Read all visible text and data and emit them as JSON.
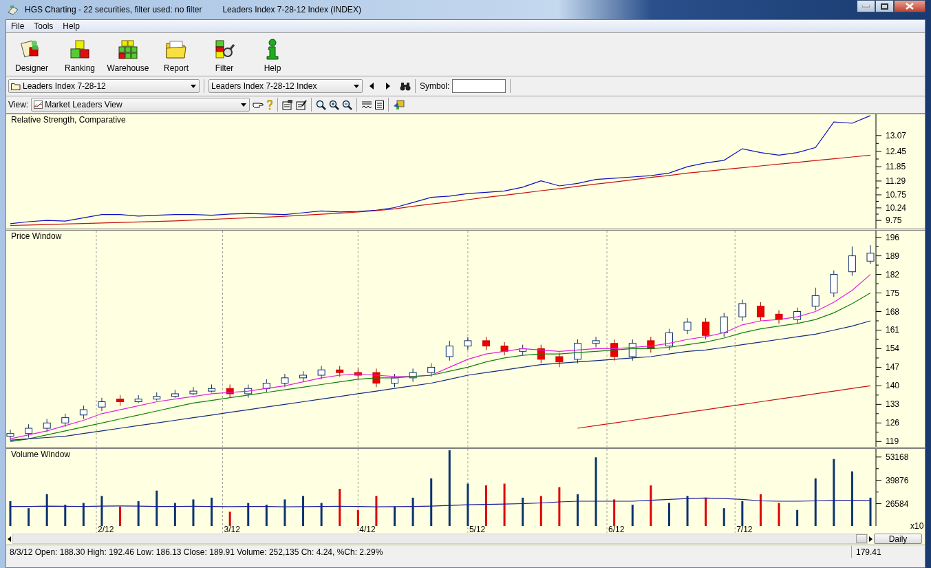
{
  "window": {
    "title": "HGS Charting - 22 securities, filter used: no filter",
    "subtitle": "Leaders Index 7-28-12 Index (INDEX)"
  },
  "menu": [
    {
      "label": "File"
    },
    {
      "label": "Tools"
    },
    {
      "label": "Help"
    }
  ],
  "toolbar": [
    {
      "label": "Designer",
      "kind": "designer"
    },
    {
      "label": "Ranking",
      "kind": "ranking"
    },
    {
      "label": "Warehouse",
      "kind": "warehouse"
    },
    {
      "label": "Report",
      "kind": "report"
    },
    {
      "label": "Filter",
      "kind": "filter"
    },
    {
      "label": "Help",
      "kind": "help"
    }
  ],
  "list_dropdown": {
    "value": "Leaders Index 7-28-12"
  },
  "security_dropdown": {
    "value": "Leaders Index 7-28-12 Index"
  },
  "symbol": {
    "label": "Symbol:"
  },
  "view": {
    "label": "View:",
    "value": "Market Leaders View"
  },
  "charts": [
    {
      "chart_data": {
        "type": "line",
        "title": "Relative Strength, Comparative",
        "ylim": [
          9.43,
          13.9
        ],
        "yticks": [
          13.07,
          12.45,
          11.85,
          11.29,
          10.75,
          10.24,
          9.75
        ],
        "series": [
          {
            "color": "#1010c0",
            "values": [
              9.62,
              9.7,
              9.75,
              9.72,
              9.85,
              9.98,
              9.98,
              9.92,
              9.95,
              9.98,
              9.98,
              9.95,
              10.0,
              10.02,
              10.0,
              9.98,
              10.05,
              10.12,
              10.08,
              10.1,
              10.15,
              10.25,
              10.45,
              10.65,
              10.7,
              10.8,
              10.85,
              10.9,
              11.05,
              11.3,
              11.1,
              11.2,
              11.35,
              11.4,
              11.45,
              11.5,
              11.6,
              11.85,
              12.0,
              12.1,
              12.55,
              12.4,
              12.3,
              12.4,
              12.6,
              13.6,
              13.55,
              13.85
            ]
          },
          {
            "color": "#c81010",
            "values": [
              9.55,
              9.57,
              9.59,
              9.61,
              9.63,
              9.65,
              9.67,
              9.69,
              9.71,
              9.73,
              9.76,
              9.79,
              9.82,
              9.85,
              9.88,
              9.91,
              9.95,
              9.99,
              10.03,
              10.08,
              10.13,
              10.2,
              10.3,
              10.39,
              10.47,
              10.56,
              10.65,
              10.73,
              10.82,
              10.91,
              10.99,
              11.08,
              11.17,
              11.25,
              11.34,
              11.43,
              11.51,
              11.6,
              11.67,
              11.74,
              11.81,
              11.88,
              11.95,
              12.02,
              12.09,
              12.16,
              12.23,
              12.3
            ]
          }
        ]
      }
    },
    {
      "chart_data": {
        "type": "candlestick",
        "title": "Price Window",
        "ylim": [
          117,
          198.5
        ],
        "yticks": [
          196,
          189,
          182,
          175,
          168,
          161,
          154,
          147,
          140,
          133,
          126,
          119
        ],
        "ohlc": [
          [
            121,
            123.5,
            119.5,
            122
          ],
          [
            122,
            125.5,
            120.5,
            124
          ],
          [
            124,
            127.5,
            122.5,
            126
          ],
          [
            126,
            129.5,
            124.5,
            128
          ],
          [
            129,
            132.5,
            127.5,
            131
          ],
          [
            132,
            135.5,
            130.5,
            134
          ],
          [
            135,
            136.5,
            132.5,
            134
          ],
          [
            134,
            136.5,
            133.5,
            135
          ],
          [
            135,
            137.5,
            134.5,
            136
          ],
          [
            136,
            138.5,
            135.5,
            137
          ],
          [
            137,
            139.5,
            136.5,
            138
          ],
          [
            138,
            140.5,
            137.5,
            139
          ],
          [
            139,
            140.5,
            135.5,
            137
          ],
          [
            137,
            140.5,
            135.5,
            139
          ],
          [
            139,
            142.5,
            137.5,
            141
          ],
          [
            141,
            144.5,
            139.5,
            143
          ],
          [
            143,
            145.5,
            141.5,
            144
          ],
          [
            144,
            147.5,
            142.5,
            146
          ],
          [
            146,
            147.5,
            143.5,
            145
          ],
          [
            145,
            146.5,
            142.5,
            144
          ],
          [
            145,
            146.5,
            139.5,
            141
          ],
          [
            141,
            144.5,
            139.5,
            143
          ],
          [
            143,
            146.5,
            141.5,
            145
          ],
          [
            145,
            148.5,
            143.5,
            147
          ],
          [
            151,
            157,
            149.5,
            155
          ],
          [
            155,
            158.5,
            153.5,
            157
          ],
          [
            157,
            158.5,
            153.5,
            155
          ],
          [
            155,
            156.5,
            151.5,
            153
          ],
          [
            153,
            155.5,
            151.5,
            154
          ],
          [
            154,
            155.5,
            148.5,
            150
          ],
          [
            151,
            152.5,
            147,
            149
          ],
          [
            150,
            157.5,
            148.5,
            156
          ],
          [
            156,
            158.5,
            154.5,
            157
          ],
          [
            156,
            157.5,
            149.5,
            151
          ],
          [
            151,
            157.5,
            149.5,
            156
          ],
          [
            157,
            158.5,
            152.5,
            154
          ],
          [
            155,
            161.5,
            153.5,
            160
          ],
          [
            161,
            165.5,
            159.5,
            164
          ],
          [
            164,
            165.5,
            157.5,
            159
          ],
          [
            160,
            167.5,
            158.5,
            166
          ],
          [
            166,
            172.5,
            164.5,
            171
          ],
          [
            170,
            171.5,
            164.5,
            166
          ],
          [
            167,
            168.5,
            163.5,
            165
          ],
          [
            165,
            169.5,
            163.5,
            168
          ],
          [
            170,
            177,
            168.5,
            174
          ],
          [
            175,
            183.5,
            173.5,
            182
          ],
          [
            183,
            192.5,
            181.5,
            189
          ],
          [
            187,
            193,
            186,
            190
          ]
        ],
        "series": [
          {
            "type": "line",
            "color": "#e020e0",
            "values": [
              120,
              121.5,
              123,
              125,
              127,
              129.5,
              131,
              132.5,
              134,
              135,
              136,
              137,
              137.5,
              138,
              139,
              140,
              141.5,
              143,
              144,
              144.5,
              144,
              143.5,
              143.5,
              144,
              147,
              150,
              152,
              153,
              154,
              153.5,
              153,
              153.5,
              154,
              154,
              154.5,
              155,
              156,
              157.5,
              158.5,
              160,
              163,
              164.5,
              165,
              166,
              168,
              171.5,
              176,
              182
            ]
          },
          {
            "type": "line",
            "color": "#108010",
            "values": [
              119,
              120,
              121.5,
              123,
              124.5,
              126,
              127.5,
              129,
              130.5,
              132,
              133.5,
              134.5,
              135.5,
              136.5,
              137.5,
              138.5,
              139.5,
              140.5,
              141.5,
              142.5,
              143,
              143,
              143.5,
              144,
              145.5,
              147,
              149,
              150.5,
              151.5,
              152,
              152,
              152.5,
              153,
              153.5,
              154,
              154,
              154.5,
              155.5,
              156.5,
              158,
              160,
              161.5,
              162.5,
              163.5,
              165,
              167.5,
              171,
              175
            ]
          },
          {
            "type": "line",
            "color": "#102a80",
            "values": [
              119.5,
              120,
              120.5,
              121,
              122,
              123,
              124,
              125,
              126,
              127,
              128,
              129,
              130,
              131,
              132,
              133,
              134,
              135,
              136,
              137,
              138,
              139,
              140,
              141,
              142.5,
              144,
              145,
              146,
              147,
              148,
              148.5,
              149,
              149.5,
              150,
              150.5,
              151,
              152,
              153,
              153.5,
              154.5,
              155.5,
              156.5,
              157.5,
              158.5,
              159.5,
              161,
              162.5,
              164.5
            ]
          },
          {
            "type": "line",
            "color": "#c81010",
            "values": [
              null,
              null,
              null,
              null,
              null,
              null,
              null,
              null,
              null,
              null,
              null,
              null,
              null,
              null,
              null,
              null,
              null,
              null,
              null,
              null,
              null,
              null,
              null,
              null,
              null,
              null,
              null,
              null,
              null,
              null,
              null,
              124,
              125,
              126,
              127,
              128,
              129,
              130,
              131,
              132,
              133,
              134,
              135,
              136,
              137,
              138,
              139,
              140
            ]
          }
        ]
      }
    },
    {
      "chart_data": {
        "type": "bar",
        "title": "Volume Window",
        "ylabel": "x10",
        "stacked": true,
        "ylim": [
          13870,
          57800
        ],
        "yticks": [
          53168,
          39876,
          26584
        ],
        "series": [
          {
            "color": "#0b3370",
            "values": [
              28000,
              24000,
              32000,
              26000,
              27000,
              31000,
              null,
              28000,
              34000,
              27000,
              29000,
              30000,
              null,
              27000,
              26000,
              29000,
              31000,
              27000,
              null,
              null,
              null,
              25000,
              30000,
              41000,
              57000,
              38000,
              null,
              null,
              30000,
              null,
              null,
              32000,
              53000,
              null,
              26000,
              null,
              27000,
              31000,
              null,
              24000,
              28000,
              null,
              null,
              23000,
              41000,
              52000,
              45000,
              30000
            ]
          },
          {
            "color": "#e00000",
            "values": [
              null,
              null,
              null,
              null,
              null,
              null,
              25000,
              null,
              null,
              null,
              null,
              null,
              22000,
              null,
              null,
              null,
              null,
              null,
              35000,
              23000,
              31000,
              null,
              null,
              null,
              null,
              null,
              37000,
              38000,
              null,
              31000,
              36000,
              null,
              null,
              29000,
              null,
              37000,
              null,
              null,
              30000,
              null,
              null,
              32000,
              27000,
              null,
              null,
              null,
              null,
              null
            ]
          },
          {
            "type": "line",
            "color": "#1a1aa0",
            "values": [
              25000,
              25000,
              25200,
              25100,
              25000,
              25200,
              25300,
              25200,
              25000,
              25000,
              25100,
              25000,
              24900,
              25000,
              25000,
              24800,
              24900,
              25000,
              25100,
              25000,
              24800,
              24900,
              25000,
              25200,
              25600,
              26000,
              26200,
              26400,
              26600,
              27000,
              27600,
              28000,
              28000,
              28000,
              28000,
              28500,
              29000,
              29500,
              29800,
              29500,
              29000,
              28200,
              28000,
              28000,
              28200,
              28500,
              28500,
              28300
            ]
          }
        ]
      }
    }
  ],
  "date_labels": [
    "2/12",
    "3/12",
    "4/12",
    "5/12",
    "6/12",
    "7/12"
  ],
  "period_button": "Daily",
  "status_bar": {
    "text": "8/3/12 Open: 188.30 High: 192.46 Low: 186.13 Close: 189.91 Volume: 252,135 Ch: 4.24, %Ch: 2.29%",
    "value": "179.41"
  }
}
